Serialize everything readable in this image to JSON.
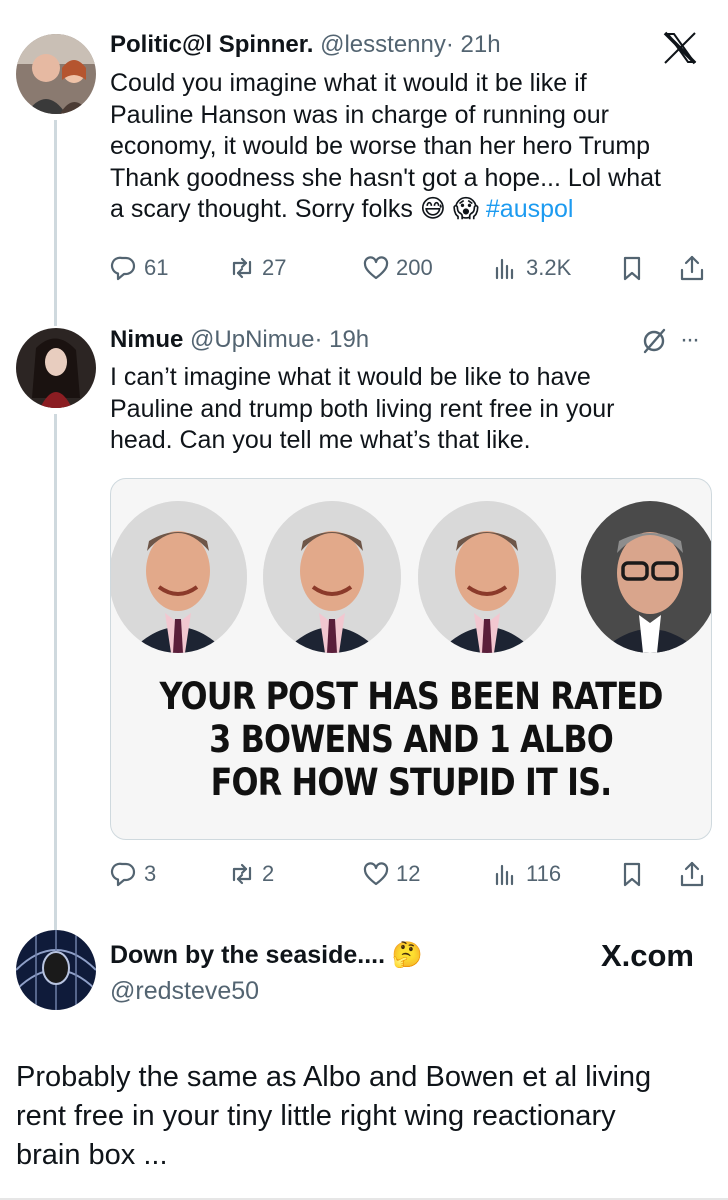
{
  "tweet1": {
    "name": "Politic@l Spinner.",
    "handle": "@lesstenny",
    "time": "· 21h",
    "text_line1": "Could you imagine what it would it be like if",
    "text_line2": "Pauline Hanson was in charge of running our",
    "text_line3": "economy, it would be worse than her hero Trump",
    "text_line4": "Thank goodness she hasn't got a hope... Lol what",
    "text_line5": "a scary thought. Sorry folks",
    "emoji1": "😅",
    "emoji2": "😱",
    "hashtag": "#auspol",
    "replies": "61",
    "reposts": "27",
    "likes": "200",
    "views": "3.2K"
  },
  "tweet2": {
    "name": "Nimue",
    "handle": "@UpNimue",
    "time": "· 19h",
    "more": "···",
    "text_line1": "I can’t imagine what it would be like to have",
    "text_line2": "Pauline and trump both living rent free in your",
    "text_line3": "head.  Can you tell me what’s that like.",
    "meme_line1": "YOUR POST HAS BEEN RATED",
    "meme_line2": "3 BOWENS AND 1 ALBO",
    "meme_line3": "FOR HOW STUPID IT IS.",
    "replies": "3",
    "reposts": "2",
    "likes": "12",
    "views": "116"
  },
  "quoted": {
    "name": "Down by the seaside....",
    "emoji": "🤔",
    "handle": "@redsteve50",
    "watermark": "X.com",
    "text_line1": "Probably the same as Albo and Bowen et al living",
    "text_line2": "rent free in your tiny little right wing reactionary",
    "text_line3": "brain box ..."
  },
  "icons": [
    "reply-icon",
    "repost-icon",
    "like-icon",
    "views-icon",
    "bookmark-icon",
    "share-icon",
    "x-logo-icon",
    "hidden-reply-icon"
  ],
  "colors": {
    "link": "#1d9bf0",
    "secondary": "#536471",
    "text": "#0f1419",
    "thread": "#cfd9de"
  }
}
